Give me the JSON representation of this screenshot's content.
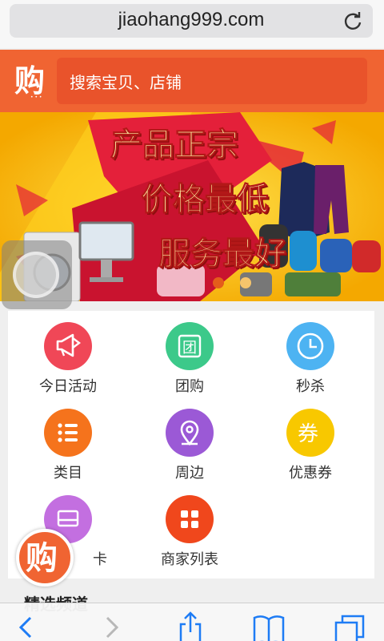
{
  "browser": {
    "url": "jiaohang999.com"
  },
  "header": {
    "logo_char": "购",
    "search_placeholder": "搜索宝贝、店铺"
  },
  "banner": {
    "line1": "产品正宗",
    "line2": "价格最低",
    "line3": "服务最好"
  },
  "menu": {
    "items": [
      {
        "label": "今日活动",
        "icon": "megaphone-icon",
        "color": "#f04757"
      },
      {
        "label": "团购",
        "icon": "group-buy-icon",
        "color": "#3cc98a",
        "glyph": "团"
      },
      {
        "label": "秒杀",
        "icon": "clock-icon",
        "color": "#4db3f2"
      },
      {
        "label": "类目",
        "icon": "list-icon",
        "color": "#f5731c"
      },
      {
        "label": "周边",
        "icon": "location-icon",
        "color": "#9b59d6"
      },
      {
        "label": "优惠券",
        "icon": "coupon-icon",
        "color": "#f8c800",
        "glyph": "券"
      },
      {
        "label": "卡",
        "icon": "card-icon",
        "color": "#c36fe0"
      },
      {
        "label": "商家列表",
        "icon": "grid-icon",
        "color": "#f0471c"
      }
    ]
  },
  "floating": {
    "logo_char": "购"
  },
  "section": {
    "title": "精选频道"
  },
  "colors": {
    "brand": "#f06432",
    "banner_bg": "#f5b800"
  }
}
